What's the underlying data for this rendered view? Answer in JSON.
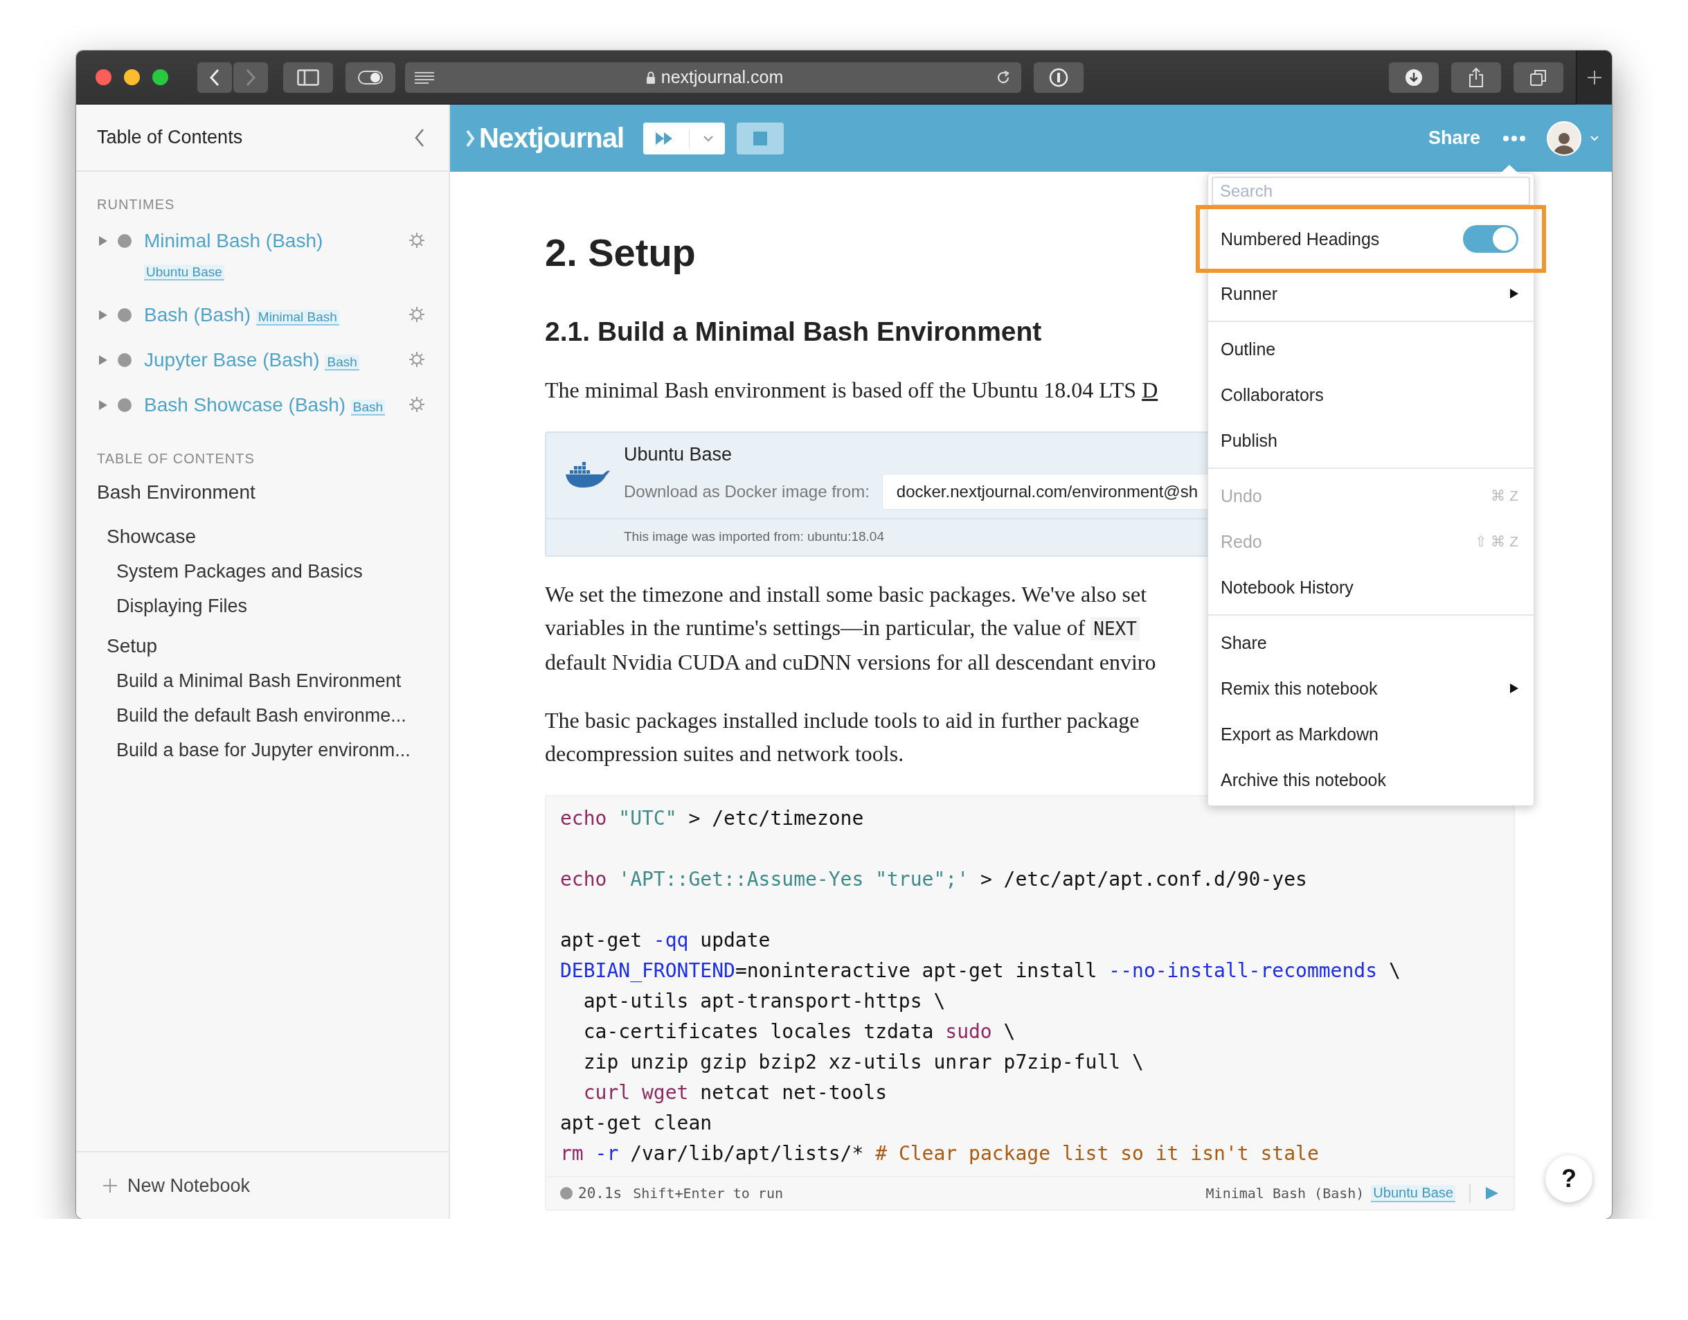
{
  "browser": {
    "url": "nextjournal.com"
  },
  "sidebar": {
    "title": "Table of Contents",
    "runtimes_label": "RUNTIMES",
    "runtimes": [
      {
        "name": "Minimal Bash (Bash)",
        "tag": "Ubuntu Base"
      },
      {
        "name": "Bash (Bash)",
        "tag": "Minimal Bash"
      },
      {
        "name": "Jupyter Base (Bash)",
        "tag": "Bash"
      },
      {
        "name": "Bash Showcase (Bash)",
        "tag": "Bash"
      }
    ],
    "toc_label": "TABLE OF CONTENTS",
    "toc": [
      {
        "label": "Bash Environment",
        "children": [
          {
            "label": "Showcase",
            "children": [
              {
                "label": "System Packages and Basics"
              },
              {
                "label": "Displaying Files"
              }
            ]
          },
          {
            "label": "Setup",
            "children": [
              {
                "label": "Build a Minimal Bash Environment"
              },
              {
                "label": "Build the default Bash environme..."
              },
              {
                "label": "Build a base for Jupyter environm..."
              }
            ]
          }
        ]
      }
    ],
    "new_notebook": "New Notebook"
  },
  "header": {
    "logo": "Nextjournal",
    "share": "Share"
  },
  "article": {
    "title": "2. Setup",
    "subtitle": "2.1. Build a Minimal Bash Environment",
    "intro": [
      {
        "kind": "text",
        "t": "The minimal Bash environment is based off the Ubuntu 18.04 LTS "
      },
      {
        "kind": "link",
        "t": "D"
      }
    ],
    "docker": {
      "title": "Ubuntu Base",
      "label": "Download as Docker image from:",
      "value": "docker.nextjournal.com/environment@sh",
      "note": "This image was imported from: ubuntu:18.04"
    },
    "paragraphs": [
      [
        {
          "kind": "text",
          "t": "We set the timezone and install some basic packages. We've also set\nvariables in the runtime's settings—in particular, the value of "
        },
        {
          "kind": "code",
          "t": "NEXT"
        },
        {
          "kind": "text",
          "t": "\ndefault Nvidia CUDA and cuDNN versions for all descendant enviro"
        }
      ],
      [
        {
          "kind": "text",
          "t": "The basic packages installed include tools to aid in further package\ndecompression suites and network tools."
        }
      ]
    ],
    "code": {
      "lines": [
        {
          "kind": "code",
          "tokens": [
            {
              "kind": "kw",
              "t": "echo"
            },
            {
              "kind": "str",
              "t": " \"UTC\""
            },
            {
              "kind": "plain",
              "t": " > /etc/timezone"
            }
          ]
        },
        {
          "kind": "blank"
        },
        {
          "kind": "code",
          "tokens": [
            {
              "kind": "kw",
              "t": "echo"
            },
            {
              "kind": "str",
              "t": " 'APT::Get::Assume-Yes \"true\";'"
            },
            {
              "kind": "plain",
              "t": " > /etc/apt/apt.conf.d/90-yes"
            }
          ]
        },
        {
          "kind": "blank"
        },
        {
          "kind": "code",
          "tokens": [
            {
              "kind": "plain",
              "t": "apt-get "
            },
            {
              "kind": "var",
              "t": "-qq"
            },
            {
              "kind": "plain",
              "t": " update"
            }
          ]
        },
        {
          "kind": "code",
          "tokens": [
            {
              "kind": "var",
              "t": "DEBIAN_FRONTEND"
            },
            {
              "kind": "plain",
              "t": "=noninteractive apt-get install "
            },
            {
              "kind": "var",
              "t": "--no-install-recommends"
            },
            {
              "kind": "plain",
              "t": " \\"
            }
          ]
        },
        {
          "kind": "code",
          "tokens": [
            {
              "kind": "plain",
              "t": "  apt-utils apt-transport-https \\"
            }
          ]
        },
        {
          "kind": "code",
          "tokens": [
            {
              "kind": "plain",
              "t": "  ca-certificates locales tzdata "
            },
            {
              "kind": "kw",
              "t": "sudo"
            },
            {
              "kind": "plain",
              "t": " \\"
            }
          ]
        },
        {
          "kind": "code",
          "tokens": [
            {
              "kind": "plain",
              "t": "  zip unzip gzip bzip2 xz-utils unrar p7zip-full \\"
            }
          ]
        },
        {
          "kind": "code",
          "tokens": [
            {
              "kind": "kw",
              "t": "  curl wget"
            },
            {
              "kind": "plain",
              "t": " netcat net-tools"
            }
          ]
        },
        {
          "kind": "code",
          "tokens": [
            {
              "kind": "plain",
              "t": "apt-get clean"
            }
          ]
        },
        {
          "kind": "code",
          "tokens": [
            {
              "kind": "kw",
              "t": "rm"
            },
            {
              "kind": "var",
              "t": " -r"
            },
            {
              "kind": "plain",
              "t": " /var/lib/apt/lists/* "
            },
            {
              "kind": "comment",
              "t": "# Clear package list so it isn't stale"
            }
          ]
        }
      ],
      "time": "20.1s",
      "hint": "Shift+Enter to run",
      "runtime": "Minimal Bash (Bash)",
      "tag": "Ubuntu Base"
    }
  },
  "menu": {
    "items": [
      {
        "kind": "search",
        "placeholder": "Search"
      },
      {
        "kind": "toggle",
        "label": "Numbered Headings",
        "on": true,
        "highlighted": true
      },
      {
        "kind": "submenu",
        "label": "Runner"
      },
      {
        "kind": "divider"
      },
      {
        "kind": "item",
        "label": "Outline",
        "disabled": false
      },
      {
        "kind": "item",
        "label": "Collaborators",
        "disabled": false
      },
      {
        "kind": "item",
        "label": "Publish",
        "disabled": false
      },
      {
        "kind": "divider"
      },
      {
        "kind": "item",
        "label": "Undo",
        "disabled": true,
        "shortcut": "⌘ Z"
      },
      {
        "kind": "item",
        "label": "Redo",
        "disabled": true,
        "shortcut": "⇧ ⌘ Z"
      },
      {
        "kind": "item",
        "label": "Notebook History",
        "disabled": false
      },
      {
        "kind": "divider"
      },
      {
        "kind": "item",
        "label": "Share",
        "disabled": false
      },
      {
        "kind": "submenu",
        "label": "Remix this notebook"
      },
      {
        "kind": "item",
        "label": "Export as Markdown",
        "disabled": false
      },
      {
        "kind": "item",
        "label": "Archive this notebook",
        "disabled": false
      }
    ]
  },
  "help": "?"
}
